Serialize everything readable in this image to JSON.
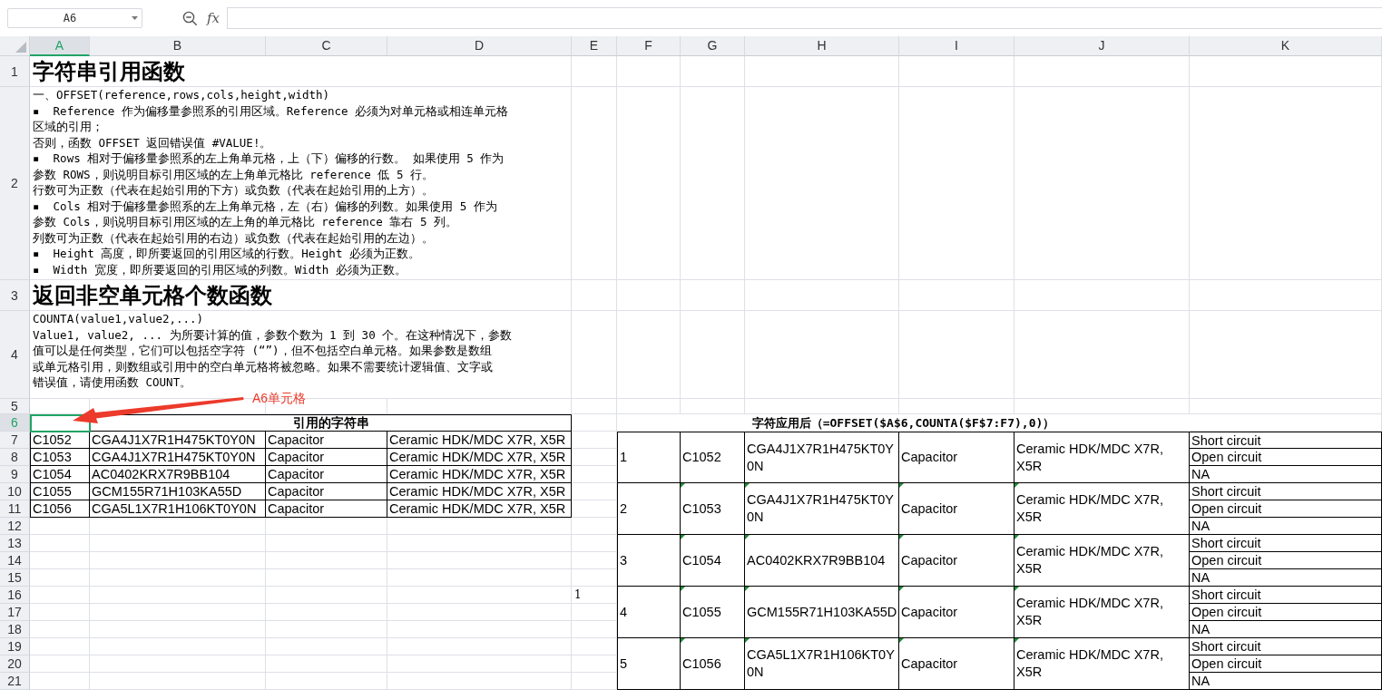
{
  "name_box": {
    "value": "A6"
  },
  "formula_bar": {
    "fx_label": "fx"
  },
  "column_headers": [
    {
      "label": "A",
      "selected": true
    },
    {
      "label": "B",
      "selected": false
    },
    {
      "label": "C",
      "selected": false
    },
    {
      "label": "D",
      "selected": false
    },
    {
      "label": "E",
      "selected": false
    },
    {
      "label": "F",
      "selected": false
    },
    {
      "label": "G",
      "selected": false
    },
    {
      "label": "H",
      "selected": false
    },
    {
      "label": "I",
      "selected": false
    },
    {
      "label": "J",
      "selected": false
    },
    {
      "label": "K",
      "selected": false
    }
  ],
  "row_headers": [
    {
      "label": "1",
      "selected": false
    },
    {
      "label": "2",
      "selected": false
    },
    {
      "label": "3",
      "selected": false
    },
    {
      "label": "4",
      "selected": false
    },
    {
      "label": "5",
      "selected": false
    },
    {
      "label": "6",
      "selected": true
    },
    {
      "label": "7",
      "selected": false
    },
    {
      "label": "8",
      "selected": false
    },
    {
      "label": "9",
      "selected": false
    },
    {
      "label": "10",
      "selected": false
    },
    {
      "label": "11",
      "selected": false
    },
    {
      "label": "12",
      "selected": false
    },
    {
      "label": "13",
      "selected": false
    },
    {
      "label": "14",
      "selected": false
    },
    {
      "label": "15",
      "selected": false
    },
    {
      "label": "16",
      "selected": false
    },
    {
      "label": "17",
      "selected": false
    },
    {
      "label": "18",
      "selected": false
    },
    {
      "label": "19",
      "selected": false
    },
    {
      "label": "20",
      "selected": false
    },
    {
      "label": "21",
      "selected": false
    }
  ],
  "notes": [
    {
      "kind": "title",
      "text": "字符串引用函数"
    },
    {
      "kind": "body",
      "lines": [
        "一、OFFSET(reference,rows,cols,height,width)",
        "▪  Reference 作为偏移量参照系的引用区域。Reference 必须为对单元格或相连单元格",
        "区域的引用；",
        "否则，函数 OFFSET 返回错误值 #VALUE!。",
        "▪  Rows 相对于偏移量参照系的左上角单元格，上（下）偏移的行数。 如果使用 5 作为",
        "参数 ROWS，则说明目标引用区域的左上角单元格比 reference 低 5 行。",
        "行数可为正数（代表在起始引用的下方）或负数（代表在起始引用的上方）。",
        "▪  Cols 相对于偏移量参照系的左上角单元格，左（右）偏移的列数。如果使用 5 作为",
        "参数 Cols，则说明目标引用区域的左上角的单元格比 reference 靠右 5 列。",
        "列数可为正数（代表在起始引用的右边）或负数（代表在起始引用的左边）。",
        "▪  Height 高度，即所要返回的引用区域的行数。Height 必须为正数。",
        "▪  Width 宽度，即所要返回的引用区域的列数。Width 必须为正数。"
      ]
    },
    {
      "kind": "title",
      "text": "返回非空单元格个数函数"
    },
    {
      "kind": "body",
      "lines": [
        "COUNTA(value1,value2,...)",
        "Value1, value2, ... 为所要计算的值，参数个数为 1 到 30 个。在这种情况下，参数",
        "值可以是任何类型，它们可以包括空字符 (“”)，但不包括空白单元格。如果参数是数组",
        "或单元格引用，则数组或引用中的空白单元格将被忽略。如果不需要统计逻辑值、文字或",
        "错误值，请使用函数 COUNT。"
      ]
    }
  ],
  "callout": {
    "text": "A6单元格"
  },
  "source_table": {
    "title": "引用的字符串",
    "rows": [
      [
        "C1052",
        "CGA4J1X7R1H475KT0Y0N",
        "Capacitor",
        "Ceramic HDK/MDC X7R, X5R"
      ],
      [
        "C1053",
        "CGA4J1X7R1H475KT0Y0N",
        "Capacitor",
        "Ceramic HDK/MDC X7R, X5R"
      ],
      [
        "C1054",
        "AC0402KRX7R9BB104",
        "Capacitor",
        "Ceramic HDK/MDC X7R, X5R"
      ],
      [
        "C1055",
        "GCM155R71H103KA55D",
        "Capacitor",
        "Ceramic HDK/MDC X7R, X5R"
      ],
      [
        "C1056",
        "CGA5L1X7R1H106KT0Y0N",
        "Capacitor",
        "Ceramic HDK/MDC X7R, X5R"
      ]
    ]
  },
  "stray_value": "1",
  "result_table": {
    "title": "字符应用后（=OFFSET($A$6,COUNTA($F$7:F7),0)）",
    "rows": [
      {
        "cells": [
          "1",
          "C1052",
          "CGA4J1X7R1H475KT0Y0N",
          "Capacitor",
          "Ceramic HDK/MDC X7R, X5R"
        ],
        "failure_modes": [
          "Short circuit",
          "Open circuit",
          "NA"
        ],
        "flagged": false
      },
      {
        "cells": [
          "2",
          "C1053",
          "CGA4J1X7R1H475KT0Y0N",
          "Capacitor",
          "Ceramic HDK/MDC X7R, X5R"
        ],
        "failure_modes": [
          "Short circuit",
          "Open circuit",
          "NA"
        ],
        "flagged": true
      },
      {
        "cells": [
          "3",
          "C1054",
          "AC0402KRX7R9BB104",
          "Capacitor",
          "Ceramic HDK/MDC X7R, X5R"
        ],
        "failure_modes": [
          "Short circuit",
          "Open circuit",
          "NA"
        ],
        "flagged": true
      },
      {
        "cells": [
          "4",
          "C1055",
          "GCM155R71H103KA55D",
          "Capacitor",
          "Ceramic HDK/MDC X7R, X5R"
        ],
        "failure_modes": [
          "Short circuit",
          "Open circuit",
          "NA"
        ],
        "flagged": true
      },
      {
        "cells": [
          "5",
          "C1056",
          "CGA5L1X7R1H106KT0Y0N",
          "Capacitor",
          "Ceramic HDK/MDC X7R, X5R"
        ],
        "failure_modes": [
          "Short circuit",
          "Open circuit",
          "NA"
        ],
        "flagged": true
      }
    ]
  }
}
